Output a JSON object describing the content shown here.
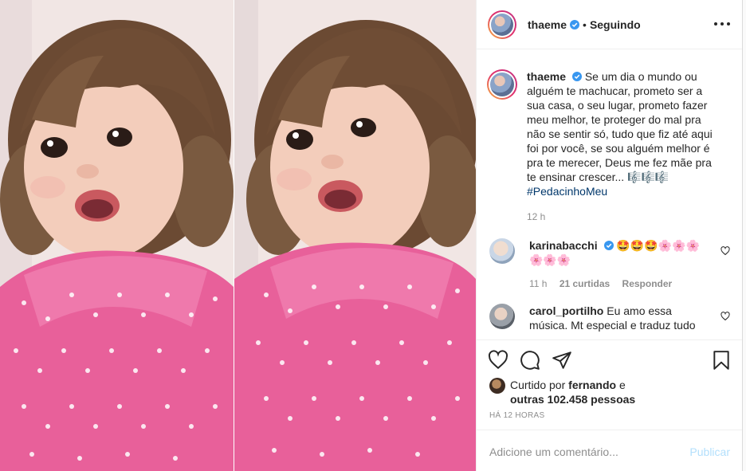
{
  "post": {
    "username": "thaeme",
    "follow_status": "Seguindo",
    "separator": "•"
  },
  "caption": {
    "username": "thaeme",
    "text": "Se um dia o mundo ou alguém te machucar, prometo ser a sua casa, o seu lugar, prometo fazer meu melhor, te proteger do mal pra não se sentir só, tudo que fiz até aqui foi por você, se sou alguém melhor é pra te merecer, Deus me fez mãe pra te ensinar crescer... 🎼🎼🎼",
    "hashtag": "#PedacinhoMeu",
    "time": "12 h"
  },
  "comments": [
    {
      "username": "karinabacchi",
      "text": "🤩🤩🤩🌸🌸🌸🌸🌸🌸",
      "time": "11 h",
      "likes": "21 curtidas",
      "reply": "Responder"
    },
    {
      "username": "carol_portilho",
      "text": "Eu amo essa música. Mt especial e traduz tudo"
    }
  ],
  "likes": {
    "prefix": "Curtido por",
    "user": "fernando",
    "connector": "e",
    "others": "outras 102.458 pessoas"
  },
  "timestamp": "HÁ 12 HORAS",
  "add_comment": {
    "placeholder": "Adicione um comentário...",
    "publish": "Publicar"
  },
  "colors": {
    "accent_link": "#00376b",
    "publish_disabled": "#b2dffc",
    "verified": "#3897f0",
    "dress_pink": "#e8609a"
  },
  "icons": [
    "more-options-icon",
    "verified-badge-icon",
    "heart-icon",
    "comment-icon",
    "share-icon",
    "bookmark-icon"
  ]
}
